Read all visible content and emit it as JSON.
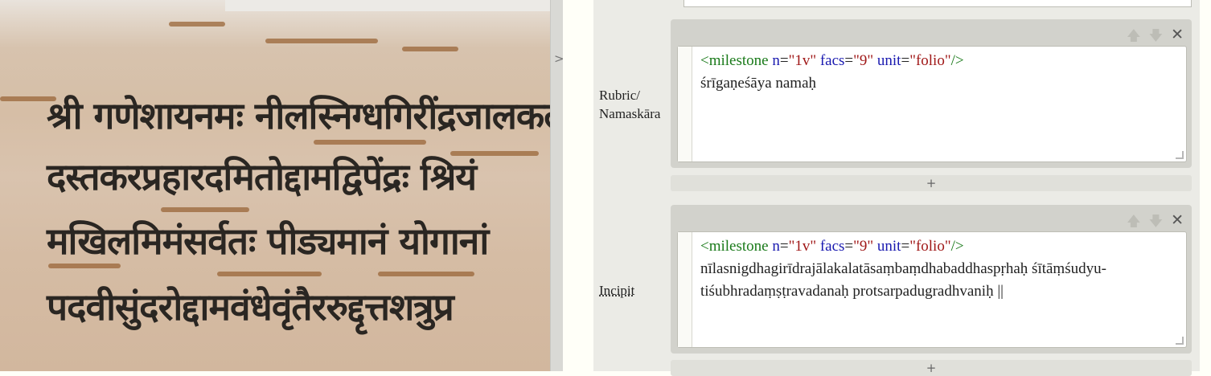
{
  "manuscript": {
    "lines": [
      "श्री गणेशायनमः नीलस्निग्धगिरींद्रजालकल",
      "दस्तकरप्रहारदमितोद्दामद्विपेंद्रः श्रियं",
      "मखिलमिमंसर्वतः पीड्यमानं योगानां",
      "पदवीसुंदरोद्दामवंधेवृंतैररुद्दृत्तशत्रुप्र"
    ]
  },
  "sidebar_toggle": ">",
  "fields": [
    {
      "label_line1": "Rubric/",
      "label_line2": "Namaskāra",
      "tag_open": "<milestone",
      "attr_n": "n",
      "val_n": "\"1v\"",
      "attr_facs": "facs",
      "val_facs": "\"9\"",
      "attr_unit": "unit",
      "val_unit": "\"folio\"",
      "tag_close": "/>",
      "text_lines": [
        "śrīgaṇeśāya namaḥ"
      ]
    },
    {
      "label_line1": "Incipit",
      "tag_open": "<milestone",
      "attr_n": "n",
      "val_n": "\"1v\"",
      "attr_facs": "facs",
      "val_facs": "\"9\"",
      "attr_unit": "unit",
      "val_unit": "\"folio\"",
      "tag_close": "/>",
      "text_lines": [
        "nīlasnigdhagirīdrajālakalatāsaṃbaṃdhabaddhaspṛhaḥ śītāṃśudyu-",
        "tiśubhradaṃṣṭravadanaḥ protsarpadugradhvaniḥ ||"
      ]
    }
  ],
  "controls": {
    "up": "🡅",
    "down": "🡇",
    "close": "✕",
    "add": "+"
  },
  "colors": {
    "tag": "#1a7a1a",
    "attr": "#1a1ab0",
    "value": "#a01818"
  }
}
